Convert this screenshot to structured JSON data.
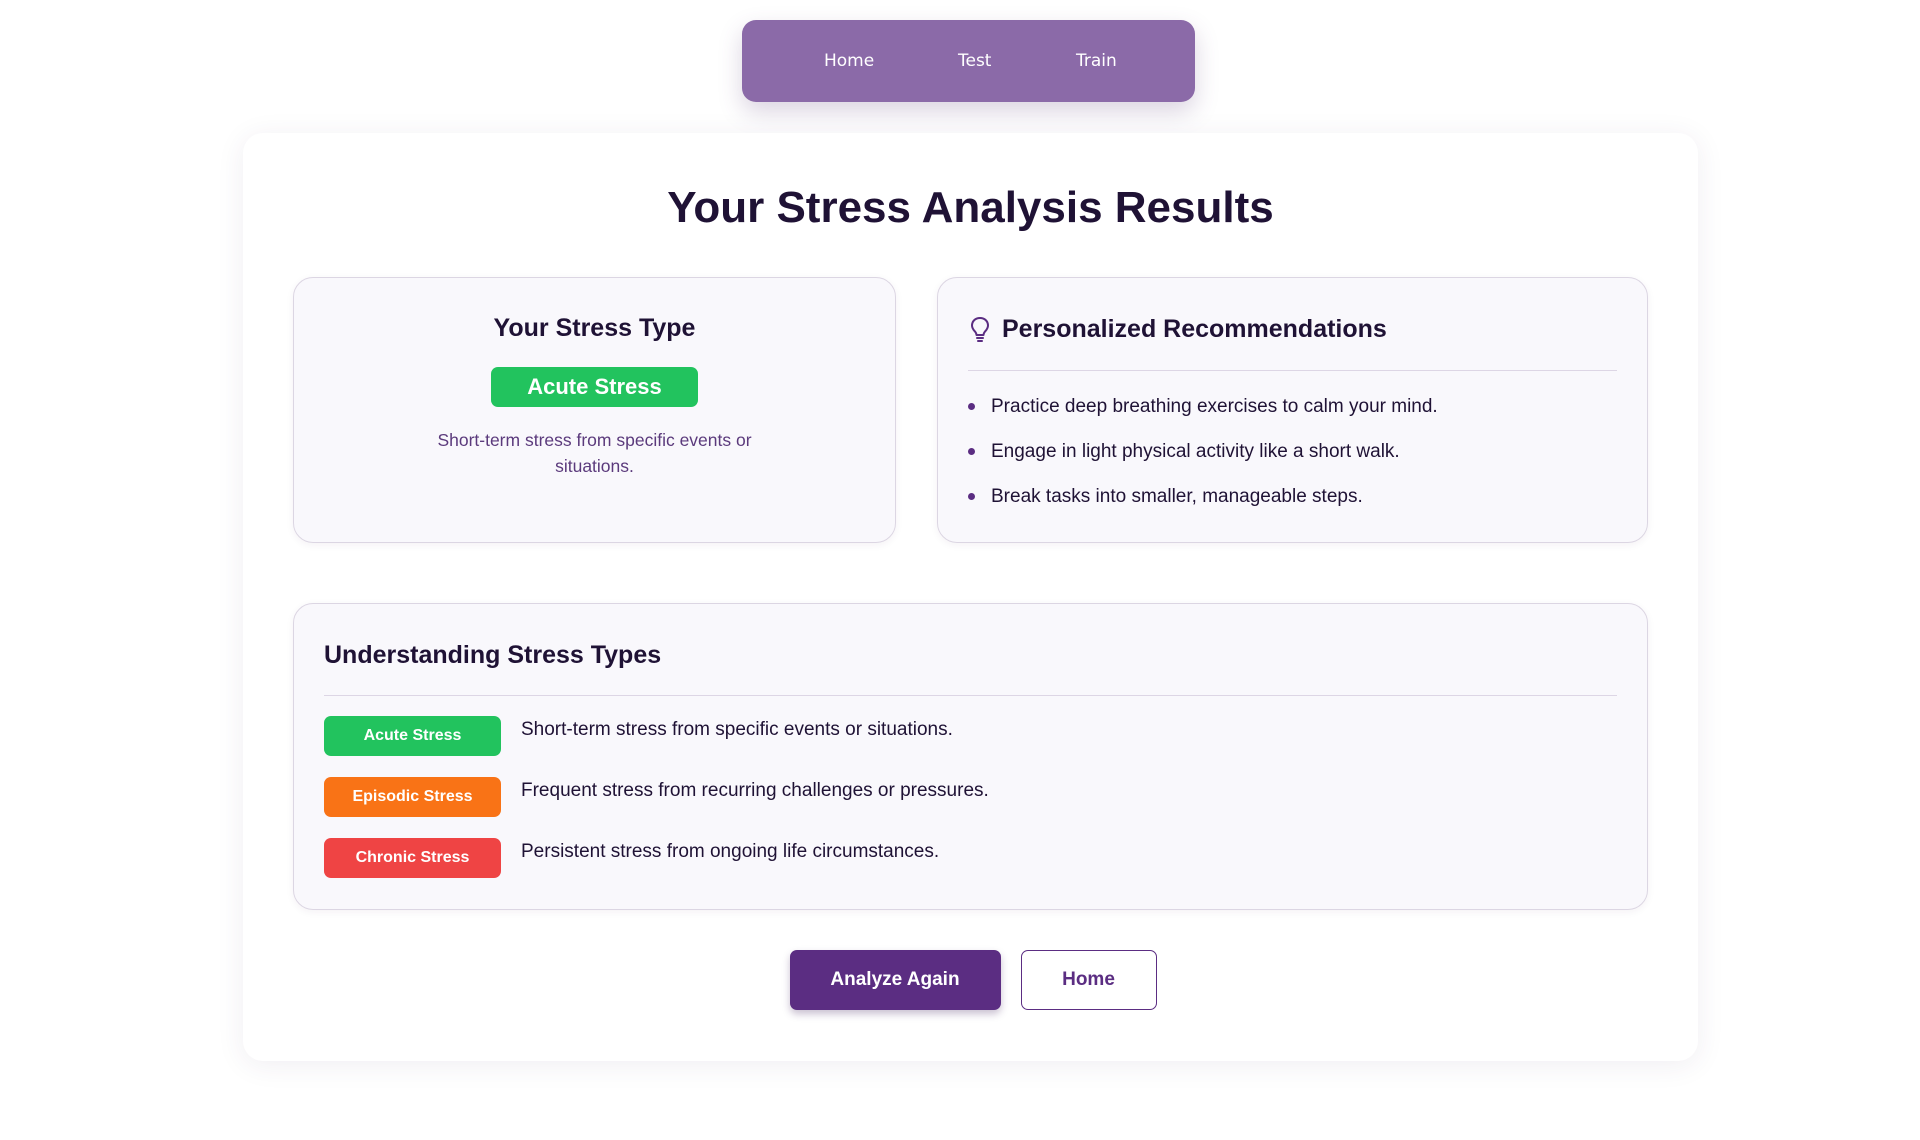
{
  "nav": {
    "items": [
      {
        "label": "Home"
      },
      {
        "label": "Test"
      },
      {
        "label": "Train"
      }
    ]
  },
  "page": {
    "title": "Your Stress Analysis Results"
  },
  "stress_type": {
    "heading": "Your Stress Type",
    "badge": "Acute Stress",
    "badge_color": "#22c35e",
    "description": "Short-term stress from specific events or situations."
  },
  "recommendations": {
    "icon": "lightbulb-icon",
    "heading": "Personalized Recommendations",
    "items": [
      "Practice deep breathing exercises to calm your mind.",
      "Engage in light physical activity like a short walk.",
      "Break tasks into smaller, manageable steps."
    ]
  },
  "understanding": {
    "heading": "Understanding Stress Types",
    "types": [
      {
        "label": "Acute Stress",
        "color": "#22c35e",
        "description": "Short-term stress from specific events or situations."
      },
      {
        "label": "Episodic Stress",
        "color": "#f97316",
        "description": "Frequent stress from recurring challenges or pressures."
      },
      {
        "label": "Chronic Stress",
        "color": "#ef4444",
        "description": "Persistent stress from ongoing life circumstances."
      }
    ]
  },
  "actions": {
    "analyze_again": "Analyze Again",
    "home": "Home"
  },
  "colors": {
    "brand": "#5b2d82",
    "nav_bg": "#8b6aa8"
  }
}
